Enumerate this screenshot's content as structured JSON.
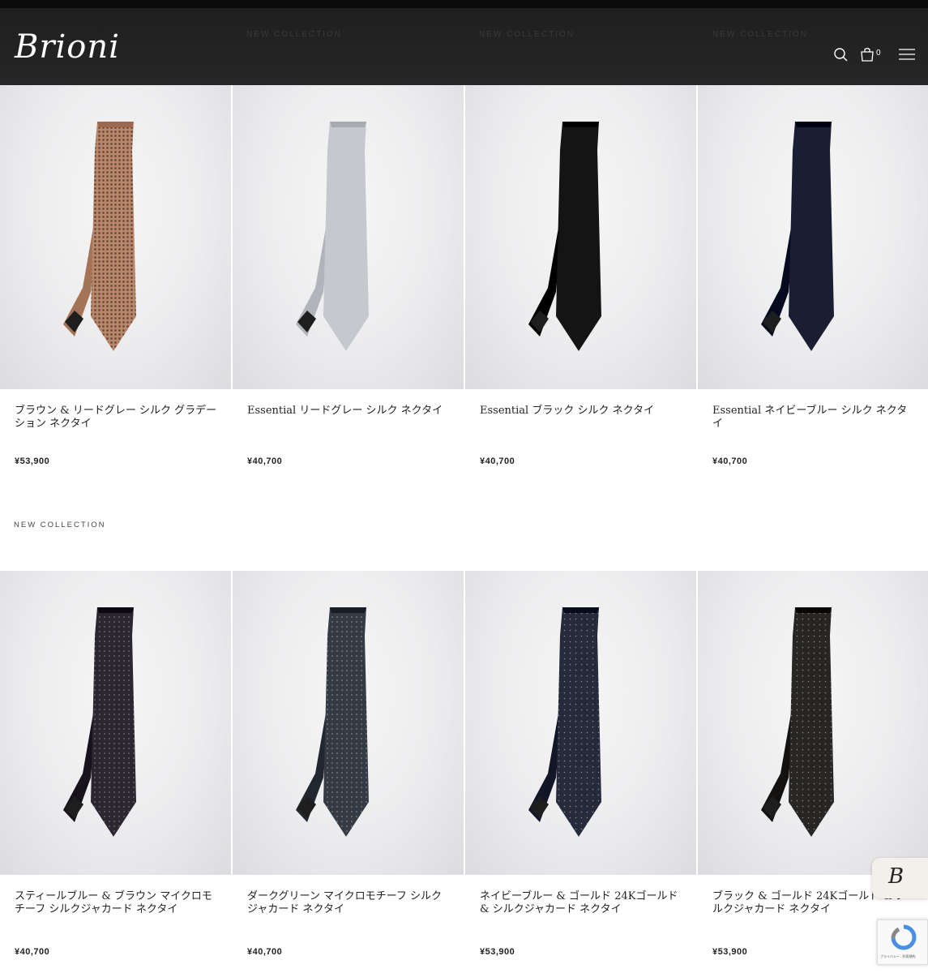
{
  "header": {
    "logo_text": "Brioni",
    "collection_tag": "NEW COLLECTION",
    "cart_count": "0",
    "icons": [
      "search-icon",
      "cart-icon",
      "menu-icon"
    ]
  },
  "section_tag": "NEW COLLECTION",
  "products": [
    {
      "name": "ブラウン & リードグレー シルク グラデーション ネクタイ",
      "price": "¥53,900",
      "color": "#b9886c",
      "pattern": "dots-dense"
    },
    {
      "name": "Essential リードグレー シルク ネクタイ",
      "price": "¥40,700",
      "color": "#c5c9ce",
      "pattern": "solid"
    },
    {
      "name": "Essential ブラック シルク ネクタイ",
      "price": "¥40,700",
      "color": "#141414",
      "pattern": "solid"
    },
    {
      "name": "Essential ネイビーブルー シルク ネクタイ",
      "price": "¥40,700",
      "color": "#1a1e33",
      "pattern": "solid"
    },
    {
      "name": "スティールブルー & ブラウン マイクロモチーフ シルクジャカード ネクタイ",
      "price": "¥40,700",
      "color": "#2c2630",
      "pattern": "dots"
    },
    {
      "name": "ダークグリーン マイクロモチーフ シルクジャカード ネクタイ",
      "price": "¥40,700",
      "color": "#353b44",
      "pattern": "dots"
    },
    {
      "name": "ネイビーブルー & ゴールド 24Kゴールド & シルクジャカード ネクタイ",
      "price": "¥53,900",
      "color": "#262b3b",
      "pattern": "dots-fine"
    },
    {
      "name": "ブラック & ゴールド 24Kゴールド & シルクジャカード ネクタイ",
      "price": "¥53,900",
      "color": "#272624",
      "pattern": "dots-fine"
    }
  ],
  "chat_widget": {
    "label": "B"
  },
  "recaptcha": {
    "text": "プライバシー - 利用規約"
  }
}
